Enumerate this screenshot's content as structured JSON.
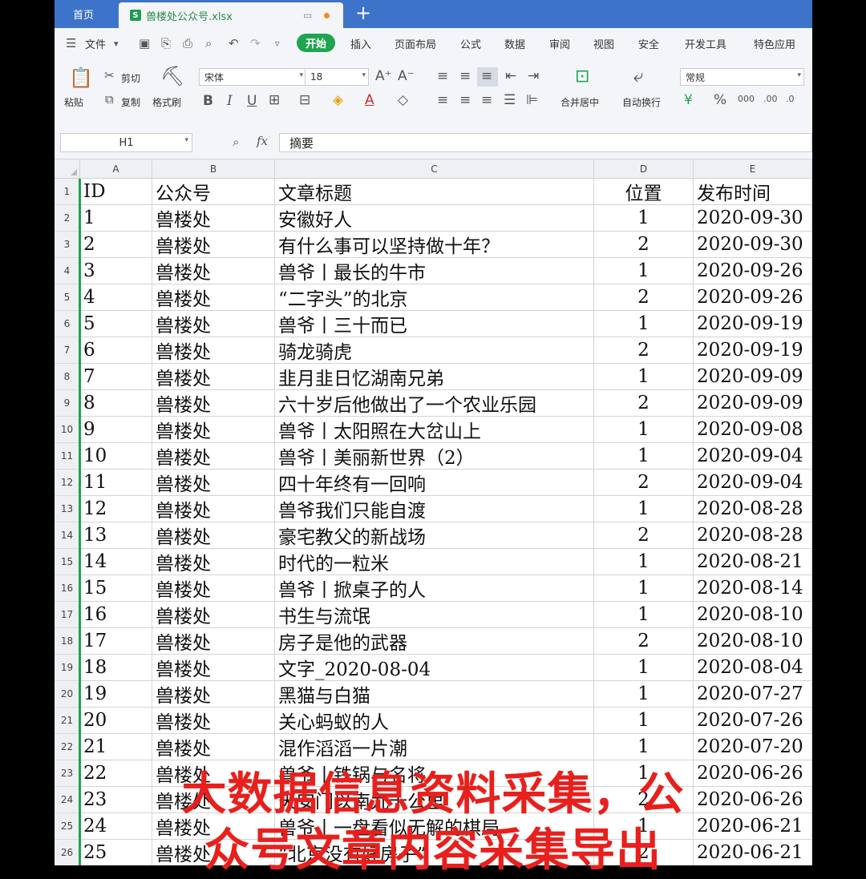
{
  "titlebar": {
    "home_tab": "首页",
    "file_tab": "兽楼处公众号.xlsx",
    "file_icon": "S"
  },
  "menubar": {
    "file_menu": "文件",
    "active_tab": "开始",
    "tabs": [
      "插入",
      "页面布局",
      "公式",
      "数据",
      "审阅",
      "视图",
      "安全",
      "开发工具",
      "特色应用"
    ]
  },
  "ribbon": {
    "paste": "粘贴",
    "cut": "剪切",
    "copy": "复制",
    "format_painter": "格式刷",
    "font_name": "宋体",
    "font_size": "18",
    "merge_center": "合并居中",
    "wrap_text": "自动换行",
    "number_format": "常规"
  },
  "formula_bar": {
    "cell_ref": "H1",
    "fx": "fx",
    "value": "摘要"
  },
  "grid": {
    "columns": [
      "A",
      "B",
      "C",
      "D",
      "E"
    ],
    "header": [
      "ID",
      "公众号",
      "文章标题",
      "位置",
      "发布时间"
    ],
    "rows": [
      [
        "1",
        "兽楼处",
        "安徽好人",
        "1",
        "2020-09-30"
      ],
      [
        "2",
        "兽楼处",
        "有什么事可以坚持做十年？",
        "2",
        "2020-09-30"
      ],
      [
        "3",
        "兽楼处",
        "兽爷丨最长的牛市",
        "1",
        "2020-09-26"
      ],
      [
        "4",
        "兽楼处",
        "“二字头”的北京",
        "2",
        "2020-09-26"
      ],
      [
        "5",
        "兽楼处",
        "兽爷丨三十而已",
        "1",
        "2020-09-19"
      ],
      [
        "6",
        "兽楼处",
        "骑龙骑虎",
        "2",
        "2020-09-19"
      ],
      [
        "7",
        "兽楼处",
        "韭月韭日忆湖南兄弟",
        "1",
        "2020-09-09"
      ],
      [
        "8",
        "兽楼处",
        "六十岁后他做出了一个农业乐园",
        "2",
        "2020-09-09"
      ],
      [
        "9",
        "兽楼处",
        "兽爷丨太阳照在大岔山上",
        "1",
        "2020-09-08"
      ],
      [
        "10",
        "兽楼处",
        "兽爷丨美丽新世界（2）",
        "1",
        "2020-09-04"
      ],
      [
        "11",
        "兽楼处",
        "四十年终有一回响",
        "2",
        "2020-09-04"
      ],
      [
        "12",
        "兽楼处",
        "兽爷我们只能自渡",
        "1",
        "2020-08-28"
      ],
      [
        "13",
        "兽楼处",
        "豪宅教父的新战场",
        "2",
        "2020-08-28"
      ],
      [
        "14",
        "兽楼处",
        "时代的一粒米",
        "1",
        "2020-08-21"
      ],
      [
        "15",
        "兽楼处",
        "兽爷丨掀桌子的人",
        "1",
        "2020-08-14"
      ],
      [
        "16",
        "兽楼处",
        "书生与流氓",
        "1",
        "2020-08-10"
      ],
      [
        "17",
        "兽楼处",
        "房子是他的武器",
        "2",
        "2020-08-10"
      ],
      [
        "18",
        "兽楼处",
        "文字_2020-08-04",
        "1",
        "2020-08-04"
      ],
      [
        "19",
        "兽楼处",
        "黑猫与白猫",
        "1",
        "2020-07-27"
      ],
      [
        "20",
        "兽楼处",
        "关心蚂蚁的人",
        "1",
        "2020-07-26"
      ],
      [
        "21",
        "兽楼处",
        "混作滔滔一片潮",
        "1",
        "2020-07-20"
      ],
      [
        "22",
        "兽楼处",
        "兽爷丨铁锅与名将",
        "1",
        "2020-06-26"
      ],
      [
        "23",
        "兽楼处",
        "天安门以南九十公里",
        "2",
        "2020-06-26"
      ],
      [
        "24",
        "兽楼处",
        "兽爷丨一盘看似无解的棋局",
        "1",
        "2020-06-21"
      ],
      [
        "25",
        "兽楼处",
        "“北京没有好房子”",
        "2",
        "2020-06-21"
      ]
    ]
  },
  "overlay": {
    "line1": "大数据信息资料采集，公",
    "line2": "众号文章内容采集导出",
    "color": "#e8201d"
  }
}
